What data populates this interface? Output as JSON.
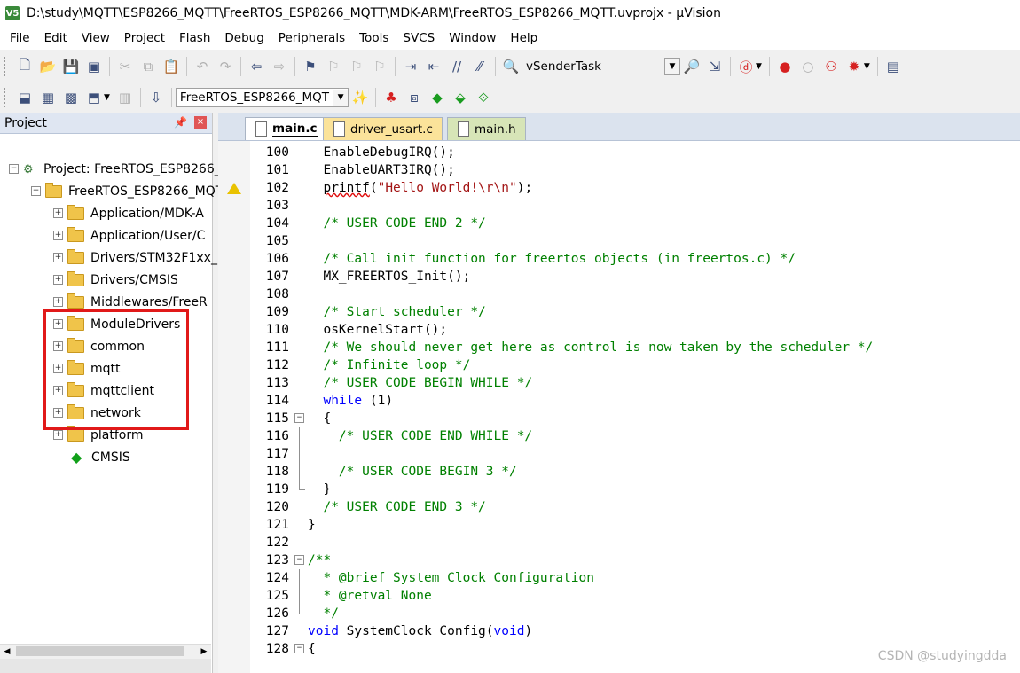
{
  "window": {
    "title": "D:\\study\\MQTT\\ESP8266_MQTT\\FreeRTOS_ESP8266_MQTT\\MDK-ARM\\FreeRTOS_ESP8266_MQTT.uvprojx - µVision",
    "icon_label": "V5"
  },
  "menu": [
    "File",
    "Edit",
    "View",
    "Project",
    "Flash",
    "Debug",
    "Peripherals",
    "Tools",
    "SVCS",
    "Window",
    "Help"
  ],
  "toolbar": {
    "find_combo": "vSenderTask",
    "target_combo": "FreeRTOS_ESP8266_MQT"
  },
  "project_panel": {
    "title": "Project",
    "pin": "ᴘ",
    "close": "×",
    "tree": [
      {
        "label": "Project: FreeRTOS_ESP8266_",
        "exp": "−",
        "icon": "project"
      },
      {
        "label": "FreeRTOS_ESP8266_MQT",
        "exp": "−",
        "icon": "target"
      },
      {
        "label": "Application/MDK-A",
        "exp": "+",
        "icon": "folder"
      },
      {
        "label": "Application/User/C",
        "exp": "+",
        "icon": "folder"
      },
      {
        "label": "Drivers/STM32F1xx_",
        "exp": "+",
        "icon": "folder"
      },
      {
        "label": "Drivers/CMSIS",
        "exp": "+",
        "icon": "folder"
      },
      {
        "label": "Middlewares/FreeR",
        "exp": "+",
        "icon": "folder"
      },
      {
        "label": "ModuleDrivers",
        "exp": "+",
        "icon": "folder"
      },
      {
        "label": "common",
        "exp": "+",
        "icon": "folder"
      },
      {
        "label": "mqtt",
        "exp": "+",
        "icon": "folder"
      },
      {
        "label": "mqttclient",
        "exp": "+",
        "icon": "folder"
      },
      {
        "label": "network",
        "exp": "+",
        "icon": "folder"
      },
      {
        "label": "platform",
        "exp": "+",
        "icon": "folder"
      },
      {
        "label": "CMSIS",
        "exp": "",
        "icon": "cmsis"
      }
    ]
  },
  "editor": {
    "tabs": [
      "main.c",
      "driver_usart.c",
      "main.h"
    ],
    "active_tab": "main.c",
    "lines": [
      {
        "n": "100",
        "fold": "",
        "parts": [
          [
            "p",
            "  EnableDebugIRQ();"
          ]
        ]
      },
      {
        "n": "101",
        "fold": "",
        "parts": [
          [
            "p",
            "  EnableUART3IRQ();"
          ]
        ]
      },
      {
        "n": "102",
        "fold": "",
        "warn": true,
        "parts": [
          [
            "p",
            "  "
          ],
          [
            "sq",
            "printf"
          ],
          [
            "p",
            "("
          ],
          [
            "s",
            "\"Hello World!\\r\\n\""
          ],
          [
            "p",
            ");"
          ]
        ]
      },
      {
        "n": "103",
        "fold": "",
        "parts": []
      },
      {
        "n": "104",
        "fold": "",
        "parts": [
          [
            "c",
            "  /* USER CODE END 2 */"
          ]
        ]
      },
      {
        "n": "105",
        "fold": "",
        "parts": []
      },
      {
        "n": "106",
        "fold": "",
        "parts": [
          [
            "c",
            "  /* Call init function for freertos objects (in freertos.c) */"
          ]
        ]
      },
      {
        "n": "107",
        "fold": "",
        "parts": [
          [
            "p",
            "  MX_FREERTOS_Init();"
          ]
        ]
      },
      {
        "n": "108",
        "fold": "",
        "parts": []
      },
      {
        "n": "109",
        "fold": "",
        "parts": [
          [
            "c",
            "  /* Start scheduler */"
          ]
        ]
      },
      {
        "n": "110",
        "fold": "",
        "parts": [
          [
            "p",
            "  osKernelStart();"
          ]
        ]
      },
      {
        "n": "111",
        "fold": "",
        "parts": [
          [
            "c",
            "  /* We should never get here as control is now taken by the scheduler */"
          ]
        ]
      },
      {
        "n": "112",
        "fold": "",
        "parts": [
          [
            "c",
            "  /* Infinite loop */"
          ]
        ]
      },
      {
        "n": "113",
        "fold": "",
        "parts": [
          [
            "c",
            "  /* USER CODE BEGIN WHILE */"
          ]
        ]
      },
      {
        "n": "114",
        "fold": "",
        "parts": [
          [
            "p",
            "  "
          ],
          [
            "k",
            "while"
          ],
          [
            "p",
            " (1)"
          ]
        ]
      },
      {
        "n": "115",
        "fold": "open",
        "parts": [
          [
            "p",
            "  {"
          ]
        ]
      },
      {
        "n": "116",
        "fold": "line",
        "parts": [
          [
            "c",
            "    /* USER CODE END WHILE */"
          ]
        ]
      },
      {
        "n": "117",
        "fold": "line",
        "parts": []
      },
      {
        "n": "118",
        "fold": "line",
        "parts": [
          [
            "c",
            "    /* USER CODE BEGIN 3 */"
          ]
        ]
      },
      {
        "n": "119",
        "fold": "end",
        "parts": [
          [
            "p",
            "  }"
          ]
        ]
      },
      {
        "n": "120",
        "fold": "",
        "parts": [
          [
            "c",
            "  /* USER CODE END 3 */"
          ]
        ]
      },
      {
        "n": "121",
        "fold": "",
        "parts": [
          [
            "p",
            "}"
          ]
        ]
      },
      {
        "n": "122",
        "fold": "",
        "parts": []
      },
      {
        "n": "123",
        "fold": "open",
        "parts": [
          [
            "c",
            "/**"
          ]
        ]
      },
      {
        "n": "124",
        "fold": "line",
        "parts": [
          [
            "c",
            "  * @brief System Clock Configuration"
          ]
        ]
      },
      {
        "n": "125",
        "fold": "line",
        "parts": [
          [
            "c",
            "  * @retval None"
          ]
        ]
      },
      {
        "n": "126",
        "fold": "end",
        "parts": [
          [
            "c",
            "  */"
          ]
        ]
      },
      {
        "n": "127",
        "fold": "",
        "parts": [
          [
            "k",
            "void"
          ],
          [
            "p",
            " SystemClock_Config("
          ],
          [
            "k",
            "void"
          ],
          [
            "p",
            ")"
          ]
        ]
      },
      {
        "n": "128",
        "fold": "open",
        "parts": [
          [
            "p",
            "{"
          ]
        ]
      }
    ]
  },
  "watermark": "CSDN @studyingdda"
}
